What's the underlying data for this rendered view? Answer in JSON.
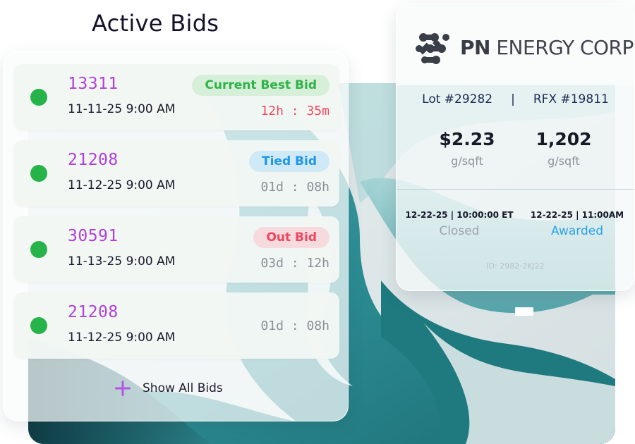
{
  "page": {
    "heading": "Active Bids"
  },
  "bids": [
    {
      "number": "13311",
      "date": "11-11-25 9:00 AM",
      "badge": "Current Best Bid",
      "badge_kind": "best",
      "time_left": "12h : 35m",
      "urgent": true
    },
    {
      "number": "21208",
      "date": "11-12-25 9:00 AM",
      "badge": "Tied Bid",
      "badge_kind": "tied",
      "time_left": "01d : 08h",
      "urgent": false
    },
    {
      "number": "30591",
      "date": "11-13-25 9:00 AM",
      "badge": "Out Bid",
      "badge_kind": "out",
      "time_left": "03d : 12h",
      "urgent": false
    },
    {
      "number": "21208",
      "date": "11-12-25 9:00 AM",
      "badge": "",
      "badge_kind": "none",
      "time_left": "01d : 08h",
      "urgent": false
    }
  ],
  "show_all": {
    "label": "Show All Bids",
    "icon": "plus-icon"
  },
  "company": {
    "name_bold": "PN",
    "name_rest": " ENERGY CORP",
    "logo_icon": "dots-logo-icon",
    "lot": "Lot #29282",
    "separator": "|",
    "rfx": "RFX #19811",
    "price": "$2.23",
    "price_unit": "g/sqft",
    "volume": "1,202",
    "volume_unit": "g/sqft",
    "events": [
      {
        "time": "12-22-25 | 10:00:00 ET",
        "status": "Closed"
      },
      {
        "time": "12-22-25 | 11:00AM",
        "status": "Awarded"
      }
    ],
    "id": "ID: 2982-2KJ22"
  },
  "colors": {
    "dot_green": "#26b34a",
    "bid_number": "#b040d9",
    "best": "#2eb249",
    "tied": "#1e96e8",
    "out": "#f0455c",
    "awarded": "#2aa0ee",
    "accent_plus": "#b455e8"
  }
}
